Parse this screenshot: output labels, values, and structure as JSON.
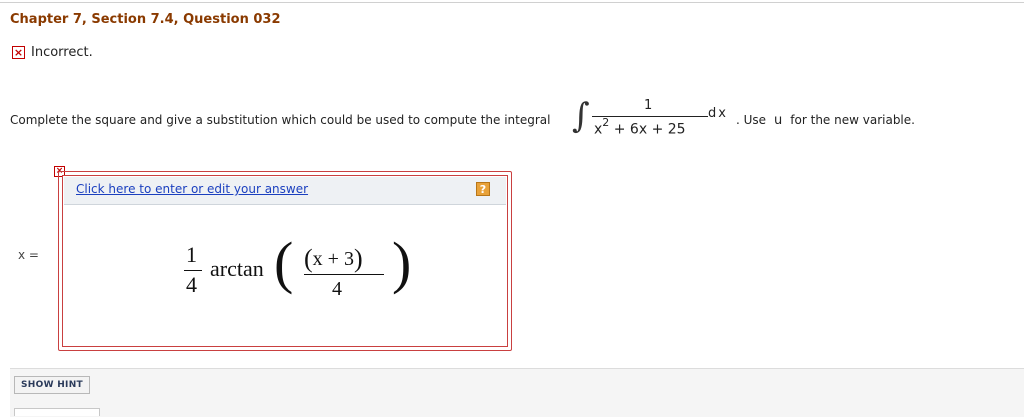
{
  "header": {
    "title": "Chapter 7, Section 7.4, Question 032"
  },
  "status": {
    "icon": "x-mark-icon",
    "mark": "×",
    "label": "Incorrect."
  },
  "question": {
    "prompt": "Complete the square and give a substitution which could be used to compute the integral",
    "integral": {
      "sign": "∫",
      "numerator": "1",
      "den_base": "x",
      "den_exp": "2",
      "den_rest": " + 6x + 25",
      "differential": "dx"
    },
    "use_text": ". Use",
    "variable": "u",
    "after_text": "for the new variable."
  },
  "answer": {
    "error_mark": "×",
    "variable_label": "x =",
    "edit_link": "Click here to enter or edit your answer",
    "help_mark": "?",
    "expression": {
      "coef_num": "1",
      "coef_den": "4",
      "func": "arctan",
      "open_big": "(",
      "close_big": ")",
      "inner_open": "(",
      "inner_text": "x + 3",
      "inner_close": ")",
      "inner_den": "4"
    }
  },
  "hint": {
    "button_label": "SHOW HINT"
  },
  "colors": {
    "title": "#8a3a00",
    "error": "#c20000",
    "link": "#1a3fbf",
    "help": "#e8a23a"
  }
}
